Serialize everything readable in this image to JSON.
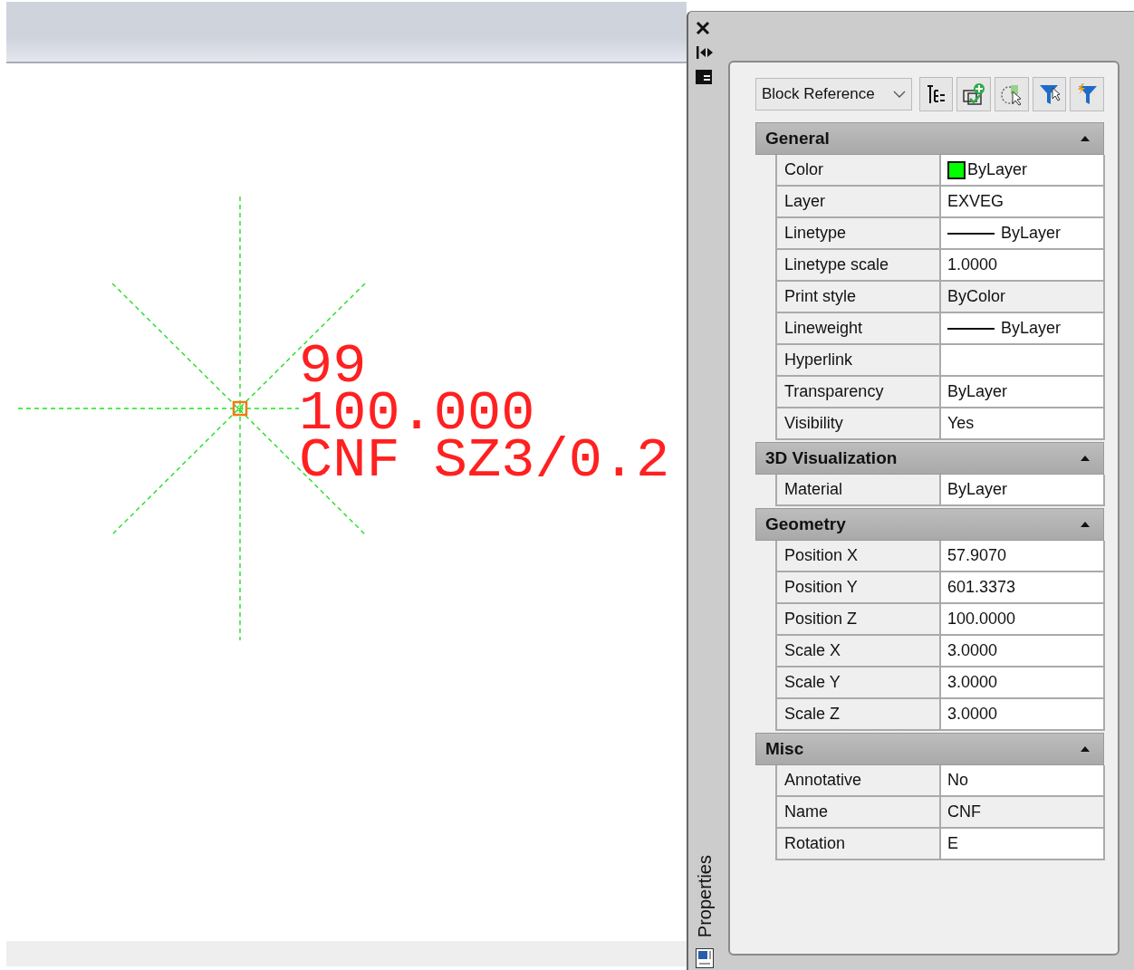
{
  "drawing": {
    "texts": [
      "99",
      "100.000",
      "CNF SZ3/0.2"
    ]
  },
  "palette": {
    "title": "Properties",
    "object_type": "Block Reference",
    "sections": [
      {
        "title": "General",
        "expanded": true,
        "rows": [
          {
            "label": "Color",
            "value": "ByLayer",
            "kind": "swatch",
            "color": "#00ff00",
            "editable": true
          },
          {
            "label": "Layer",
            "value": "EXVEG",
            "kind": "text",
            "editable": true
          },
          {
            "label": "Linetype",
            "value": "ByLayer",
            "kind": "line",
            "editable": true
          },
          {
            "label": "Linetype scale",
            "value": "1.0000",
            "kind": "text",
            "editable": true
          },
          {
            "label": "Print style",
            "value": "ByColor",
            "kind": "text",
            "editable": false
          },
          {
            "label": "Lineweight",
            "value": "ByLayer",
            "kind": "line",
            "editable": true
          },
          {
            "label": "Hyperlink",
            "kind": "text",
            "editable": true
          },
          {
            "label": "Transparency",
            "value": "ByLayer",
            "kind": "text",
            "editable": true
          },
          {
            "label": "Visibility",
            "value": "Yes",
            "kind": "text",
            "editable": true
          }
        ]
      },
      {
        "title": "3D Visualization",
        "expanded": true,
        "rows": [
          {
            "label": "Material",
            "value": "ByLayer",
            "kind": "text",
            "editable": true
          }
        ]
      },
      {
        "title": "Geometry",
        "expanded": true,
        "rows": [
          {
            "label": "Position X",
            "value": "57.9070",
            "kind": "text",
            "editable": true
          },
          {
            "label": "Position Y",
            "value": "601.3373",
            "kind": "text",
            "editable": true
          },
          {
            "label": "Position Z",
            "value": "100.0000",
            "kind": "text",
            "editable": true
          },
          {
            "label": "Scale X",
            "value": "3.0000",
            "kind": "text",
            "editable": true
          },
          {
            "label": "Scale Y",
            "value": "3.0000",
            "kind": "text",
            "editable": true
          },
          {
            "label": "Scale Z",
            "value": "3.0000",
            "kind": "text",
            "editable": true
          }
        ]
      },
      {
        "title": "Misc",
        "expanded": true,
        "rows": [
          {
            "label": "Annotative",
            "value": "No",
            "kind": "text",
            "editable": true
          },
          {
            "label": "Name",
            "value": "CNF",
            "kind": "text",
            "editable": false
          },
          {
            "label": "Rotation",
            "value": "E",
            "kind": "text",
            "editable": true
          }
        ]
      }
    ]
  }
}
